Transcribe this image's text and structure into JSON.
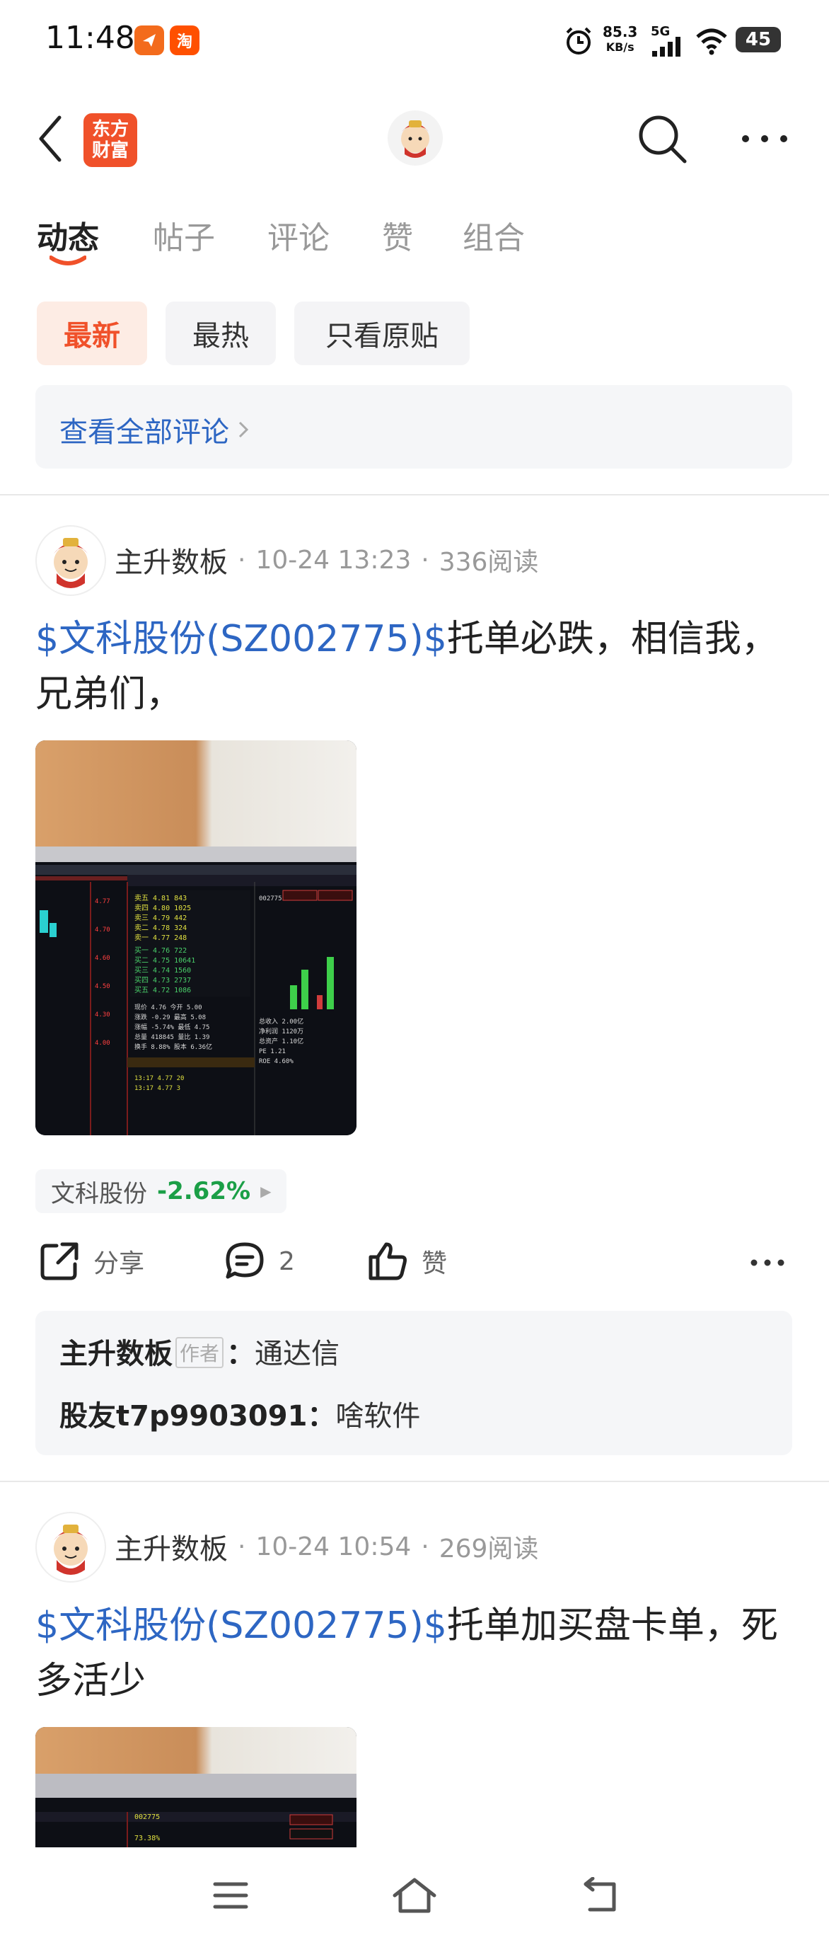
{
  "status_bar": {
    "time": "11:48",
    "net_speed_value": "85.3",
    "net_speed_unit": "KB/s",
    "network": "5G",
    "battery": "45",
    "app_badge_2": "淘"
  },
  "header": {
    "logo_line1": "东方",
    "logo_line2": "财富"
  },
  "tabs": [
    {
      "label": "动态"
    },
    {
      "label": "帖子"
    },
    {
      "label": "评论"
    },
    {
      "label": "赞"
    },
    {
      "label": "组合"
    }
  ],
  "filters": [
    {
      "label": "最新"
    },
    {
      "label": "最热"
    },
    {
      "label": "只看原贴"
    }
  ],
  "view_all_comments": "查看全部评论",
  "posts": [
    {
      "author": "主升数板",
      "time": "10-24 13:23",
      "reads": "336阅读",
      "stock_ref": "$文科股份(SZ002775)$",
      "text": "托单必跌，相信我，兄弟们，",
      "stock_chip": {
        "name": "文科股份",
        "change": "-2.62%"
      },
      "share_label": "分享",
      "comment_count": "2",
      "like_label": "赞",
      "comments": [
        {
          "user": "主升数板",
          "tag": "作者",
          "text": "通达信"
        },
        {
          "user": "股友t7p9903091",
          "text": "啥软件"
        }
      ]
    },
    {
      "author": "主升数板",
      "time": "10-24 10:54",
      "reads": "269阅读",
      "stock_ref": "$文科股份(SZ002775)$",
      "text": "托单加买盘卡单，死多活少"
    }
  ],
  "colors": {
    "accent": "#f0512a",
    "link": "#2d66c3",
    "down": "#1b9f47"
  }
}
